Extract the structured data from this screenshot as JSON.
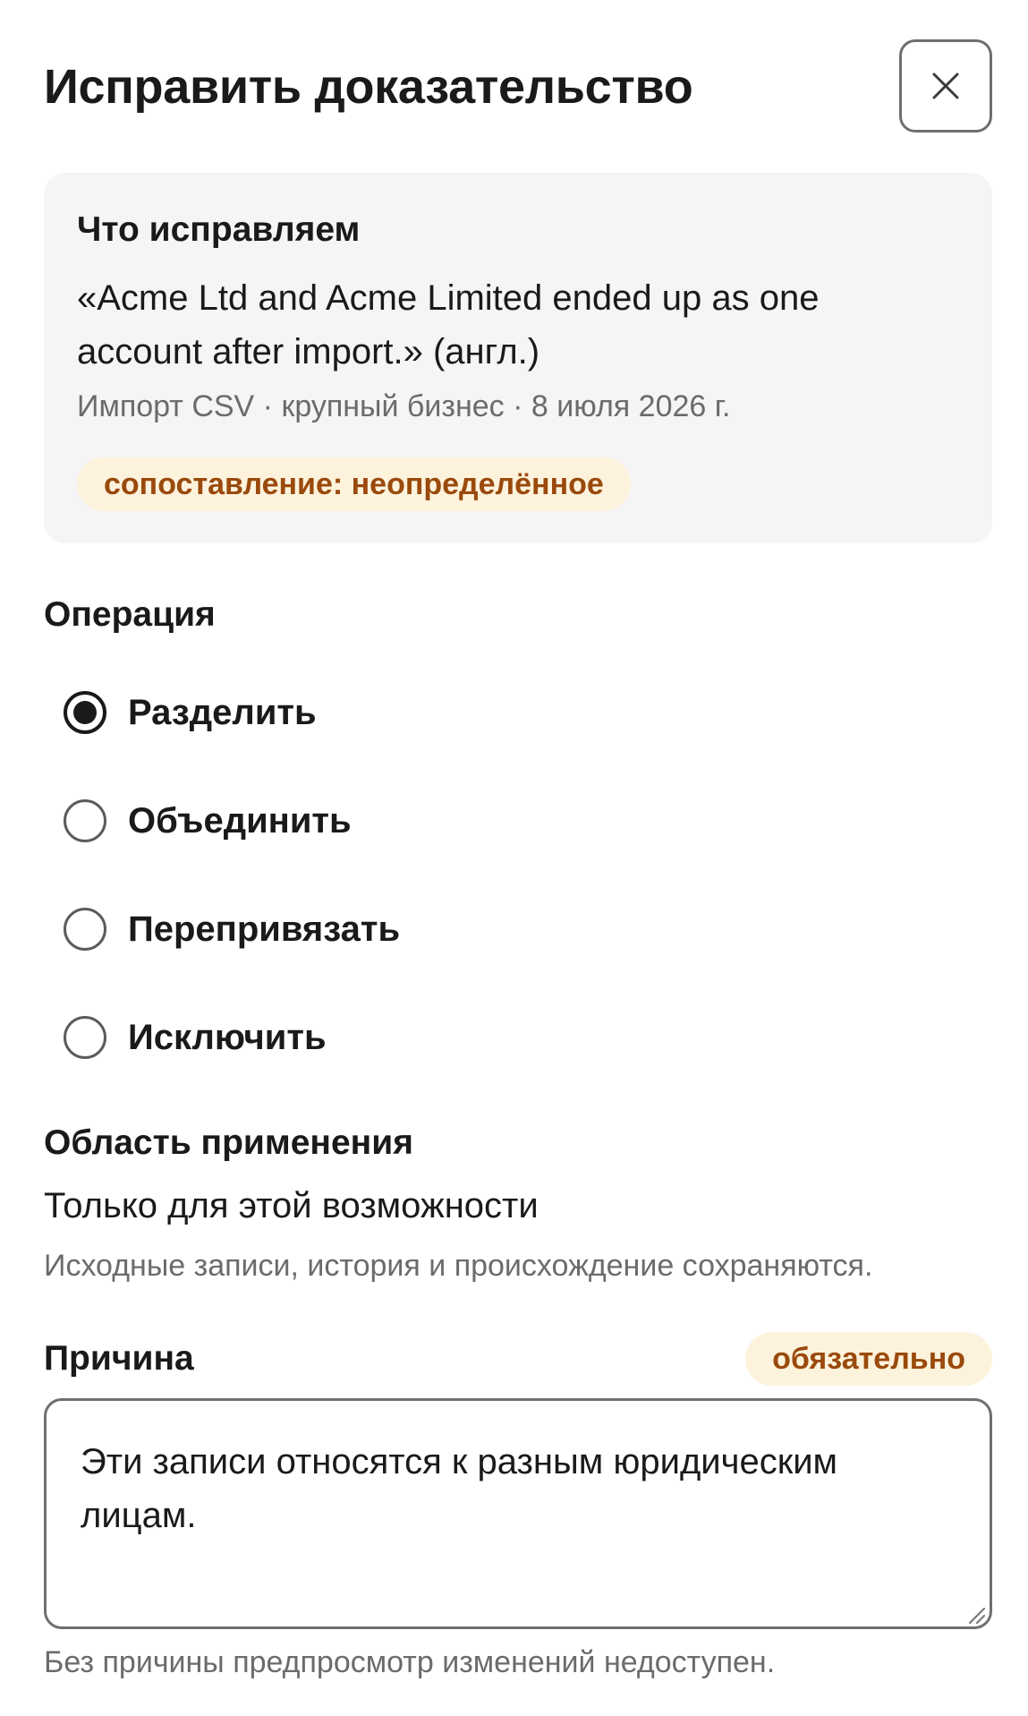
{
  "dialog": {
    "title": "Исправить доказательство",
    "close_label": "×"
  },
  "context": {
    "heading": "Что исправляем",
    "quote": "«Acme Ltd and Acme Limited ended up as one account after import.» (англ.)",
    "meta": "Импорт CSV · крупный бизнес · 8 июля 2026 г.",
    "badge": "сопоставление: неопределённое",
    "badge_color": "#9a4a0c",
    "badge_bg": "#fdf3dc"
  },
  "operation": {
    "label": "Операция",
    "options": [
      {
        "label": "Разделить",
        "selected": true
      },
      {
        "label": "Объединить",
        "selected": false
      },
      {
        "label": "Перепривязать",
        "selected": false
      },
      {
        "label": "Исключить",
        "selected": false
      }
    ]
  },
  "scope": {
    "label": "Область применения",
    "value": "Только для этой возможности",
    "note": "Исходные записи, история и происхождение сохраняются."
  },
  "reason": {
    "label": "Причина",
    "required_badge": "обязательно",
    "value": "Эти записи относятся к разным юридическим лицам.",
    "hint": "Без причины предпросмотр изменений недоступен."
  }
}
